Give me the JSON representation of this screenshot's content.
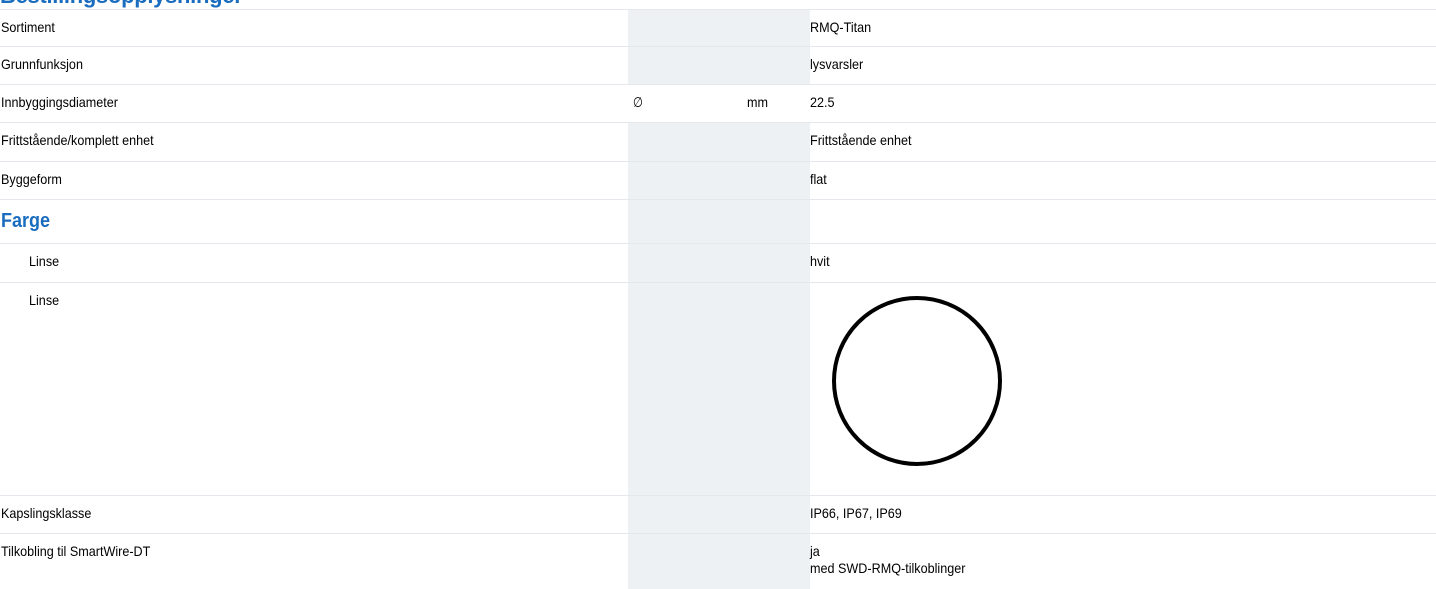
{
  "section_heading_cut": "Bestillingsopplysninger",
  "rows": [
    {
      "label": "Sortiment",
      "symbol": "",
      "unit": "",
      "value": "RMQ-Titan"
    },
    {
      "label": "Grunnfunksjon",
      "symbol": "",
      "unit": "",
      "value": "lysvarsler"
    },
    {
      "label": "Innbyggingsdiameter",
      "symbol": "∅",
      "unit": "mm",
      "value": "22.5"
    },
    {
      "label": "Frittstående/komplett enhet",
      "symbol": "",
      "unit": "",
      "value": "Frittstående enhet"
    },
    {
      "label": "Byggeform",
      "symbol": "",
      "unit": "",
      "value": "flat"
    },
    {
      "group": "Farge"
    },
    {
      "label": "Linse",
      "symbol": "",
      "unit": "",
      "value": "hvit"
    },
    {
      "label": "Linse",
      "symbol": "",
      "unit": "",
      "value": "",
      "image": "white-lens-circle-icon"
    },
    {
      "label": "Kapslingsklasse",
      "symbol": "",
      "unit": "",
      "value": "IP66, IP67, IP69"
    },
    {
      "label": "Tilkobling til SmartWire-DT",
      "symbol": "",
      "unit": "",
      "value": "ja",
      "value_line2": "med SWD-RMQ-tilkoblinger"
    }
  ],
  "colors": {
    "heading_blue": "#1a6cbf",
    "shaded_column": "#eef1f4",
    "row_divider": "#e4e8ec"
  }
}
